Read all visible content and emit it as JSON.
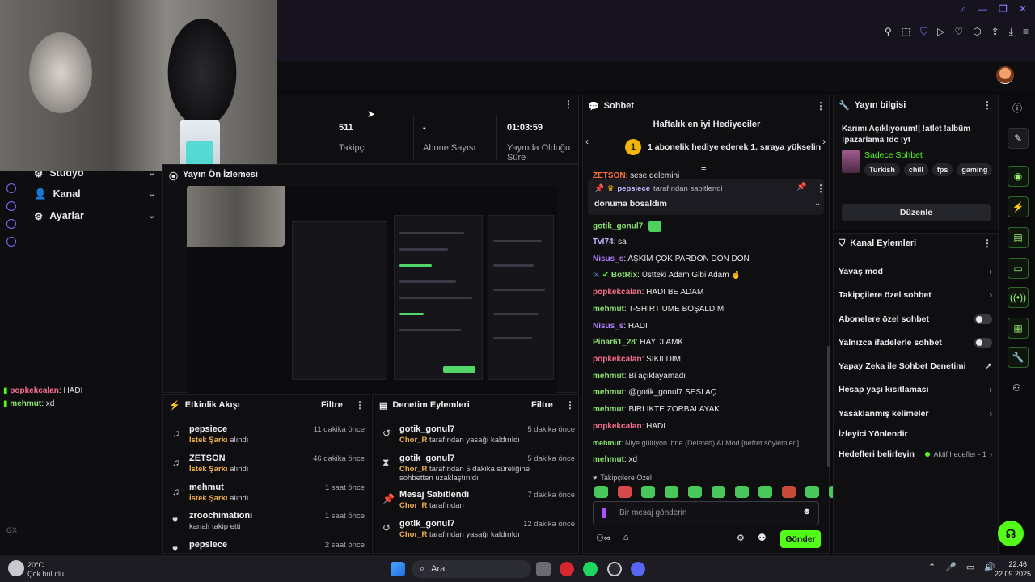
{
  "nav": {
    "items": [
      {
        "label": "Stüdyo",
        "icon": "gear-icon"
      },
      {
        "label": "Kanal",
        "icon": "user-icon"
      },
      {
        "label": "Ayarlar",
        "icon": "gear-icon"
      }
    ],
    "mini_chat": [
      {
        "user": "popkekcalan",
        "text": "HADİ"
      },
      {
        "user": "mehmut",
        "text": "xd"
      }
    ],
    "bottom_label": "GX"
  },
  "stats": {
    "items": [
      {
        "value": "511",
        "label": "Takipçi"
      },
      {
        "value": "-",
        "label": "Abone Sayısı"
      },
      {
        "value": "01:03:59",
        "label": "Yayında Olduğu Süre"
      }
    ]
  },
  "preview": {
    "title": "Yayın Ön İzlemesi"
  },
  "activity": {
    "title": "Etkinlik Akışı",
    "filter": "Filtre",
    "items": [
      {
        "name": "pepsiece",
        "highlight": "İstek Şarkı",
        "rest": "alındı",
        "time": "11 dakika önce",
        "icon": "song-icon"
      },
      {
        "name": "ZETSON",
        "highlight": "İstek Şarkı",
        "rest": "alındı",
        "time": "46 dakika önce",
        "icon": "song-icon"
      },
      {
        "name": "mehmut",
        "highlight": "İstek Şarkı",
        "rest": "alındı",
        "time": "1 saat önce",
        "icon": "song-icon"
      },
      {
        "name": "zroochimationi",
        "highlight": "",
        "rest": "kanalı takip etti",
        "time": "1 saat önce",
        "icon": "heart-icon"
      },
      {
        "name": "pepsiece",
        "highlight": "",
        "rest": "",
        "time": "2 saat önce",
        "icon": "heart-icon"
      }
    ]
  },
  "moderation": {
    "title": "Denetim Eylemleri",
    "filter": "Filtre",
    "items": [
      {
        "name": "gotik_gonul7",
        "highlight": "Chor_R",
        "rest": "tarafından yasağı kaldırıldı",
        "time": "5 dakika önce",
        "icon": "undo-icon"
      },
      {
        "name": "gotik_gonul7",
        "highlight": "Chor_R",
        "rest": "tarafından 5 dakika süreliğine sohbetten uzaklaştırıldı",
        "time": "5 dakika önce",
        "icon": "hourglass-icon"
      },
      {
        "name": "Mesaj Sabitlendi",
        "highlight": "Chor_R",
        "rest": "tarafından",
        "time": "7 dakika önce",
        "icon": "pin-icon"
      },
      {
        "name": "gotik_gonul7",
        "highlight": "Chor_R",
        "rest": "tarafından yasağı kaldırıldı",
        "time": "12 dakika önce",
        "icon": "undo-icon"
      }
    ]
  },
  "chat": {
    "title": "Sohbet",
    "gifters_title": "Haftalık en iyi Hediyeciler",
    "gift_badge": "1",
    "gift_text": "1 abonelik hediye ederek 1. sıraya yükselin",
    "top_msg": {
      "user": "ZETSON",
      "text": ": sese gelemini"
    },
    "pinned": {
      "user": "pepsiece",
      "by": "tarafından sabitlendi",
      "text": "donuma bosaldım"
    },
    "messages": [
      {
        "user": "gotik_gonul7",
        "color": "green",
        "text": ":",
        "emote": true
      },
      {
        "user": "Tvl74",
        "color": "lav",
        "text": ": sa"
      },
      {
        "user": "Nisus_s",
        "color": "purple",
        "text": ": AŞKIM ÇOK PARDON DON DON"
      },
      {
        "user": "BotRix",
        "color": "green",
        "text": ": Üstteki Adam Gibi Adam 🤞"
      },
      {
        "user": "popkekcalan",
        "color": "pink",
        "text": ": HADİ BE ADAM"
      },
      {
        "user": "mehmut",
        "color": "green",
        "text": ": T-SHIRT UME BOŞALDIM"
      },
      {
        "user": "Nisus_s",
        "color": "purple",
        "text": ": HADİ"
      },
      {
        "user": "Pinar61_28",
        "color": "green",
        "text": ": HAYDİ AMK"
      },
      {
        "user": "popkekcalan",
        "color": "pink",
        "text": ": SİKİLDİM"
      },
      {
        "user": "mehmut",
        "color": "green",
        "text": ": Bi açıklayamadı"
      },
      {
        "user": "mehmut",
        "color": "green",
        "text": ": @gotik_gonul7 SESİ AÇ"
      },
      {
        "user": "mehmut",
        "color": "green",
        "text": ": BİRLİKTE ZORBALAYAK"
      },
      {
        "user": "popkekcalan",
        "color": "pink",
        "text": ": HADİ"
      },
      {
        "user": "mehmut",
        "color": "green",
        "text": ": Niye gülüyon ibne (Deleted) AI Mod [nefret söylemleri]"
      },
      {
        "user": "mehmut",
        "color": "green",
        "text": ": xd"
      }
    ],
    "followers_only": "Takipçilere Özel",
    "input_placeholder": "Bir mesaj gönderin",
    "send_label": "Gönder"
  },
  "stream_info": {
    "title": "Yayın bilgisi",
    "stream_title": "Karımı Açıklıyorum!| !atlet !albüm !pazarlama !dc !yt",
    "category": "Sadece Sohbet",
    "tags": [
      "Turkish",
      "chill",
      "fps",
      "gaming"
    ],
    "edit_label": "Düzenle"
  },
  "channel_actions": {
    "title": "Kanal Eylemleri",
    "items": [
      {
        "label": "Yavaş mod",
        "control": "chevron"
      },
      {
        "label": "Takipçilere özel sohbet",
        "control": "chevron"
      },
      {
        "label": "Abonelere özel sohbet",
        "control": "toggle"
      },
      {
        "label": "Yalnızca ifadelerle sohbet",
        "control": "toggle"
      },
      {
        "label": "Yapay Zeka ile Sohbet Denetimi",
        "control": "external"
      },
      {
        "label": "Hesap yaşı kısıtlaması",
        "control": "chevron"
      },
      {
        "label": "Yasaklanmış kelimeler",
        "control": "chevron"
      },
      {
        "label": "İzleyici Yönlendir",
        "control": "none"
      },
      {
        "label": "Hedefleri belirleyin",
        "control": "goal"
      }
    ],
    "active_goals": "Aktif hedefler - 1"
  },
  "taskbar": {
    "weather_temp": "20°C",
    "weather_desc": "Çok bulutlu",
    "search_label": "Ara",
    "time": "22:46",
    "date": "22.09.2025"
  },
  "colors": {
    "accent": "#53fc18",
    "brand_purple": "#8d7cff"
  }
}
